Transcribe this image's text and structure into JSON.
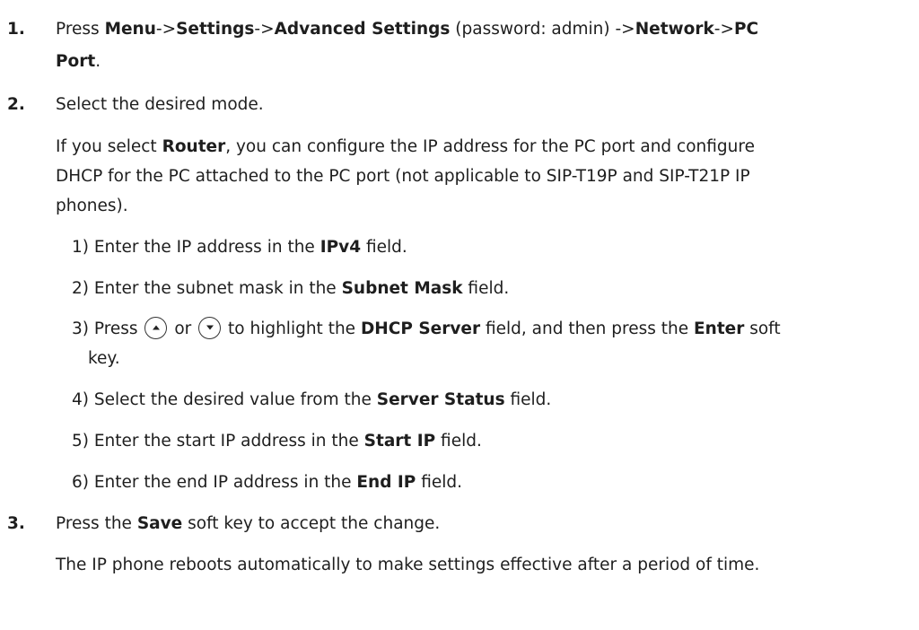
{
  "steps": [
    {
      "number": "1.",
      "line1": [
        {
          "t": "Press ",
          "b": false
        },
        {
          "t": "Menu",
          "b": true
        },
        {
          "t": "->",
          "b": false
        },
        {
          "t": "Settings",
          "b": true
        },
        {
          "t": "->",
          "b": false
        },
        {
          "t": "Advanced Settings",
          "b": true
        },
        {
          "t": " (password: admin) ->",
          "b": false
        },
        {
          "t": "Network",
          "b": true
        },
        {
          "t": "->",
          "b": false
        },
        {
          "t": "PC",
          "b": true
        }
      ],
      "line2": [
        {
          "t": "Port",
          "b": true
        },
        {
          "t": ".",
          "b": false
        }
      ]
    },
    {
      "number": "2.",
      "line1": [
        {
          "t": "Select the desired mode.",
          "b": false
        }
      ],
      "router_para": [
        [
          {
            "t": "If you select ",
            "b": false
          },
          {
            "t": "Router",
            "b": true
          },
          {
            "t": ", you can configure the IP address for the PC port and configure",
            "b": false
          }
        ],
        [
          {
            "t": "DHCP for the PC attached to the PC port (not applicable to SIP-T19P and SIP-T21P IP",
            "b": false
          }
        ],
        [
          {
            "t": "phones).",
            "b": false
          }
        ]
      ],
      "substeps": {
        "s1": [
          {
            "t": "1) Enter the IP address in the ",
            "b": false
          },
          {
            "t": "IPv4",
            "b": true
          },
          {
            "t": " field.",
            "b": false
          }
        ],
        "s2": [
          {
            "t": "2) Enter the subnet mask in the ",
            "b": false
          },
          {
            "t": "Subnet Mask",
            "b": true
          },
          {
            "t": " field.",
            "b": false
          }
        ],
        "s3a": [
          {
            "t": "3) Press ",
            "b": false
          }
        ],
        "s3b": [
          {
            "t": " or ",
            "b": false
          }
        ],
        "s3c": [
          {
            "t": " to highlight the ",
            "b": false
          },
          {
            "t": "DHCP Server",
            "b": true
          },
          {
            "t": " field, and then press the ",
            "b": false
          },
          {
            "t": "Enter",
            "b": true
          },
          {
            "t": " soft",
            "b": false
          }
        ],
        "s3d": [
          {
            "t": "key.",
            "b": false
          }
        ],
        "s4": [
          {
            "t": "4) Select the desired value from the ",
            "b": false
          },
          {
            "t": "Server Status",
            "b": true
          },
          {
            "t": " field.",
            "b": false
          }
        ],
        "s5": [
          {
            "t": "5) Enter the start IP address in the ",
            "b": false
          },
          {
            "t": "Start IP",
            "b": true
          },
          {
            "t": " field.",
            "b": false
          }
        ],
        "s6": [
          {
            "t": "6) Enter the end IP address in the ",
            "b": false
          },
          {
            "t": "End IP",
            "b": true
          },
          {
            "t": " field.",
            "b": false
          }
        ]
      }
    },
    {
      "number": "3.",
      "line1": [
        {
          "t": "Press the ",
          "b": false
        },
        {
          "t": "Save",
          "b": true
        },
        {
          "t": " soft key to accept the change.",
          "b": false
        }
      ],
      "note": [
        {
          "t": "The IP phone reboots automatically to make settings effective after a period of time.",
          "b": false
        }
      ]
    }
  ],
  "icons": {
    "up": "up-arrow-key-icon",
    "down": "down-arrow-key-icon"
  }
}
